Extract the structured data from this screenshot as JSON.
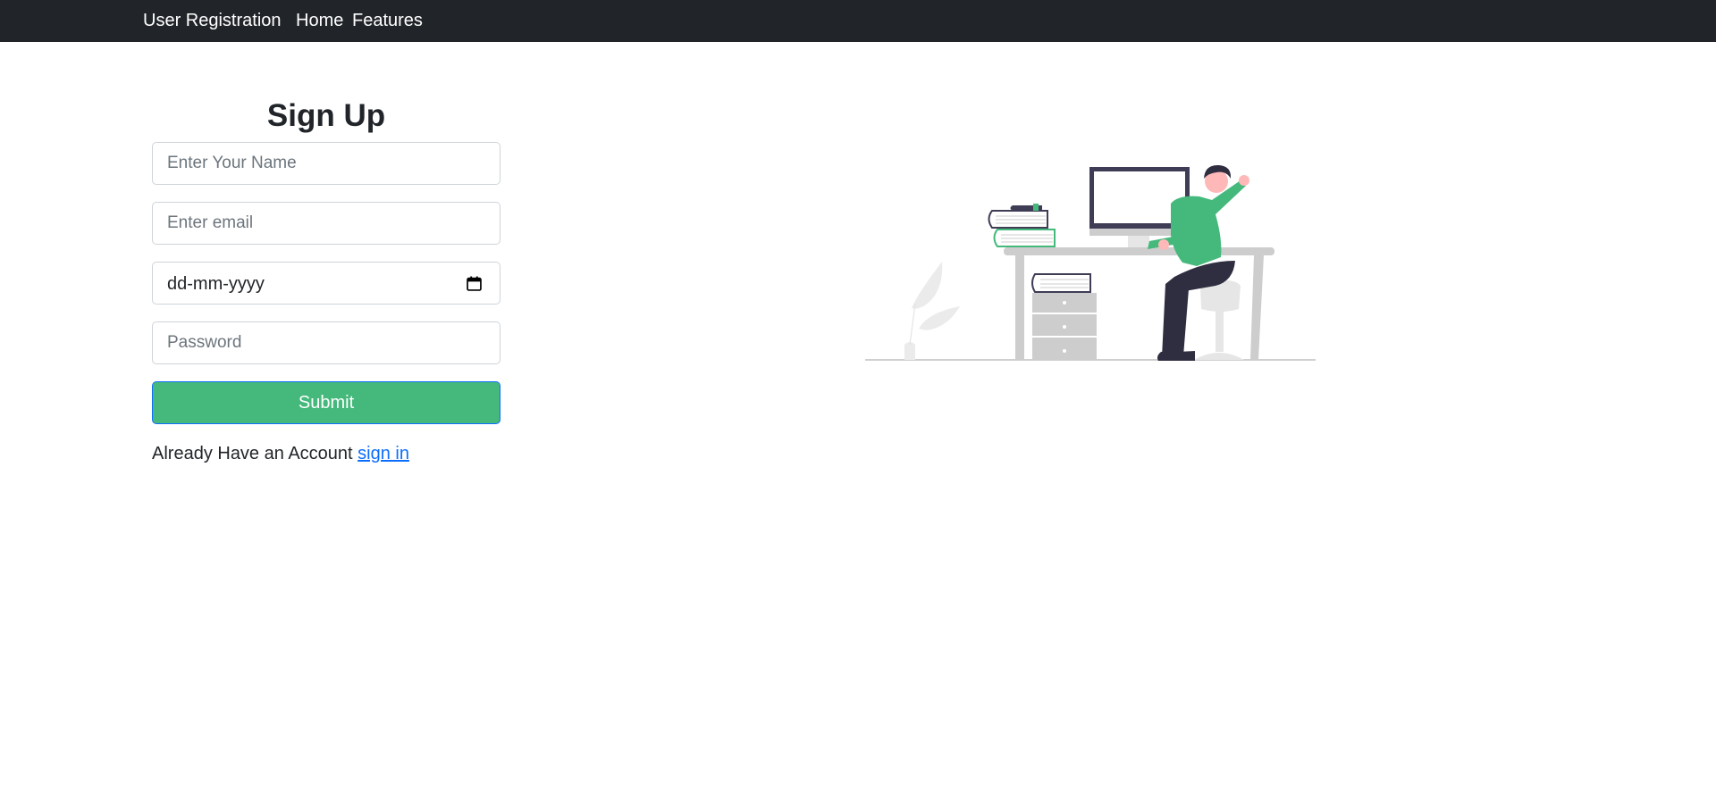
{
  "navbar": {
    "brand": "User Registration",
    "links": [
      {
        "label": "Home"
      },
      {
        "label": "Features"
      }
    ]
  },
  "form": {
    "title": "Sign Up",
    "name_placeholder": "Enter Your Name",
    "email_placeholder": "Enter email",
    "date_placeholder": "dd-mm-yyyy",
    "password_placeholder": "Password",
    "submit_label": "Submit",
    "signin_prompt": "Already Have an Account",
    "signin_link": "sign in"
  },
  "colors": {
    "navbar_bg": "#212529",
    "accent_green": "#45b97c",
    "link_blue": "#0d6efd"
  },
  "illustration": {
    "icon": "person-at-desk-illustration"
  }
}
